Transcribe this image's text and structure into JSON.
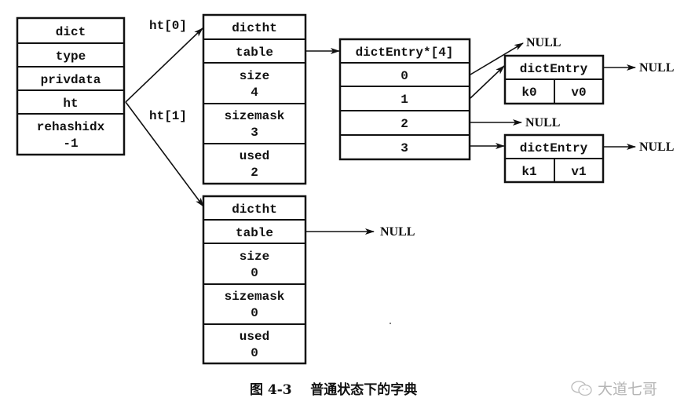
{
  "dict": {
    "title": "dict",
    "fields": [
      {
        "label": "type"
      },
      {
        "label": "privdata"
      },
      {
        "label": "ht"
      },
      {
        "label": "rehashidx",
        "value": "-1"
      }
    ]
  },
  "ht_labels": [
    "ht[0]",
    "ht[1]"
  ],
  "dictht0": {
    "title": "dictht",
    "table_label": "table",
    "fields": [
      {
        "label": "size",
        "value": "4"
      },
      {
        "label": "sizemask",
        "value": "3"
      },
      {
        "label": "used",
        "value": "2"
      }
    ]
  },
  "dictht1": {
    "title": "dictht",
    "table_label": "table",
    "table_target": "NULL",
    "fields": [
      {
        "label": "size",
        "value": "0"
      },
      {
        "label": "sizemask",
        "value": "0"
      },
      {
        "label": "used",
        "value": "0"
      }
    ]
  },
  "bucket_array": {
    "title": "dictEntry*[4]",
    "buckets": [
      "0",
      "1",
      "2",
      "3"
    ],
    "bucket_targets": [
      "NULL",
      "dictEntry(k0,v0)",
      "NULL",
      "dictEntry(k1,v1)"
    ]
  },
  "entries": [
    {
      "title": "dictEntry",
      "key": "k0",
      "value": "v0",
      "next": "NULL"
    },
    {
      "title": "dictEntry",
      "key": "k1",
      "value": "v1",
      "next": "NULL"
    }
  ],
  "null_label": "NULL",
  "caption": "图 4-3    普通状态下的字典",
  "watermark": {
    "icon": "wechat-icon",
    "text": "大道七哥"
  }
}
